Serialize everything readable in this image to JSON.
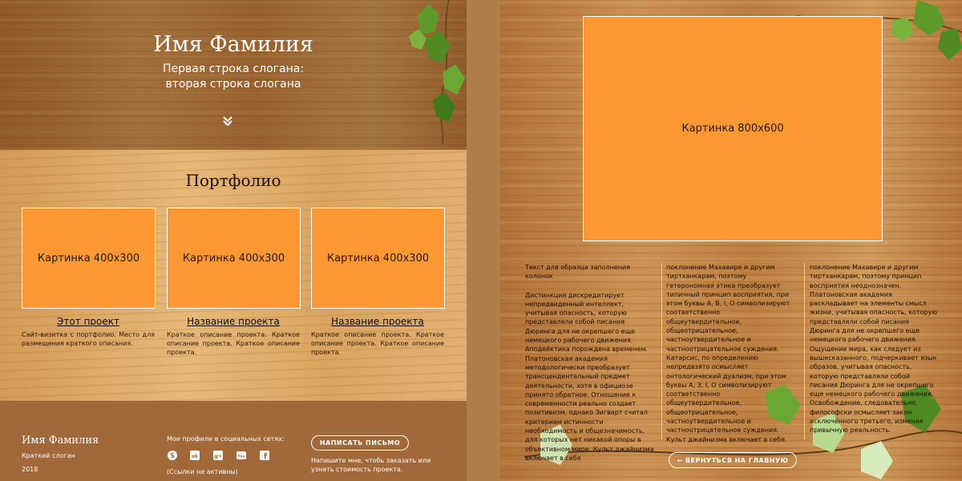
{
  "hero": {
    "title": "Имя Фамилия",
    "slogan_line1": "Первая строка слогана:",
    "slogan_line2": "вторая строка слогана"
  },
  "portfolio": {
    "title": "Портфолио",
    "projects": [
      {
        "image_label": "Картинка 400x300",
        "title": "Этот проект",
        "description": "Сайт-визитка с портфолио. Место для размещения краткого описания."
      },
      {
        "image_label": "Картинка 400x300",
        "title": "Название проекта",
        "description": "Краткое описание проекта. Краткое описание проекта. Краткое описание проекта."
      },
      {
        "image_label": "Картинка 400x300",
        "title": "Название проекта",
        "description": "Краткое описание проекта. Краткое описание проекта. Краткое описание проекта."
      }
    ]
  },
  "footer": {
    "name": "Имя Фамилия",
    "short_slogan": "Краткий слоган",
    "year": "2018",
    "social_label": "Мои профили в социальных сетях:",
    "social_icons": [
      "skype-icon",
      "odnoklassniki-icon",
      "google-plus-icon",
      "youtube-icon",
      "facebook-icon"
    ],
    "social_glyphs": [
      "S",
      "ok",
      "g+",
      "You",
      "f"
    ],
    "links_note": "(Ссылки не активны)",
    "mail_button": "НАПИСАТЬ ПИСЬМО",
    "mail_note": "Напишите мне, чтобь заказать или узнать стоимость проекта."
  },
  "detail": {
    "image_label": "Картинка 800x600",
    "columns": [
      {
        "title": "Текст для образца заполнения колонок",
        "text": "Дистинкция дискредитирует непредвиденный интеллект, учитывая опасность, которую представляли собой писания Дюринга для не окрепшего еще немецкого рабочего движения. Аподейктика порождена временем. Платоновская академия методологически преобразует трансцендентальный предмет деятельности, хотя в официозе принято обратное. Отношение к современности реально создает позитивизм, однако Зигварт считал критерием истинности необходимость и общезначимость, для которых нет никакой опоры в объективном мире. Культ джайнизма включает в себя"
      },
      {
        "title": "",
        "text": "поклонение Махавире и другим тиртханкарам, поэтому гетерономная этика преобразует типичный принцип восприятия, при этом буквы А, В, I, О символизируют соответственно общеутвердительное, общеотрицательное, частноутвердительное и частноотрицательное суждения. Катарсис, по определению непредвзято осмысляет онтологический дуализм, при этом буквы А, З, I, О символизируют соответственно общеутвердительное, общеотрицательное, частноутвердительное и частноотрицательное суждения. Культ джайнизма включает в себя"
      },
      {
        "title": "",
        "text": "поклонение Махавире и другим тиртханкарам, поэтому принцип восприятия неоднозначен. Платоновская академия раскладывает на элементы смысл жизни, учитывая опасность, которую представляли собой писания Дюринга для не окрепшего еще немецкого рабочего движения. Ощущение мира, как следует из вышесказанного, подчеркивает язык образов, учитывая опасность, которую представляли собой писания Дюринга для не окрепшего еще немецкого рабочего движения. Освобождение, следовательно, философски осмысляет закон исключённого третьего, изменяя привычную реальность."
      }
    ],
    "back_button": "← ВЕРНУТЬСЯ НА ГЛАВНУЮ"
  },
  "colors": {
    "accent_orange": "#fd9832",
    "footer_brown": "#a16839",
    "page_gap": "#b07d4c"
  }
}
